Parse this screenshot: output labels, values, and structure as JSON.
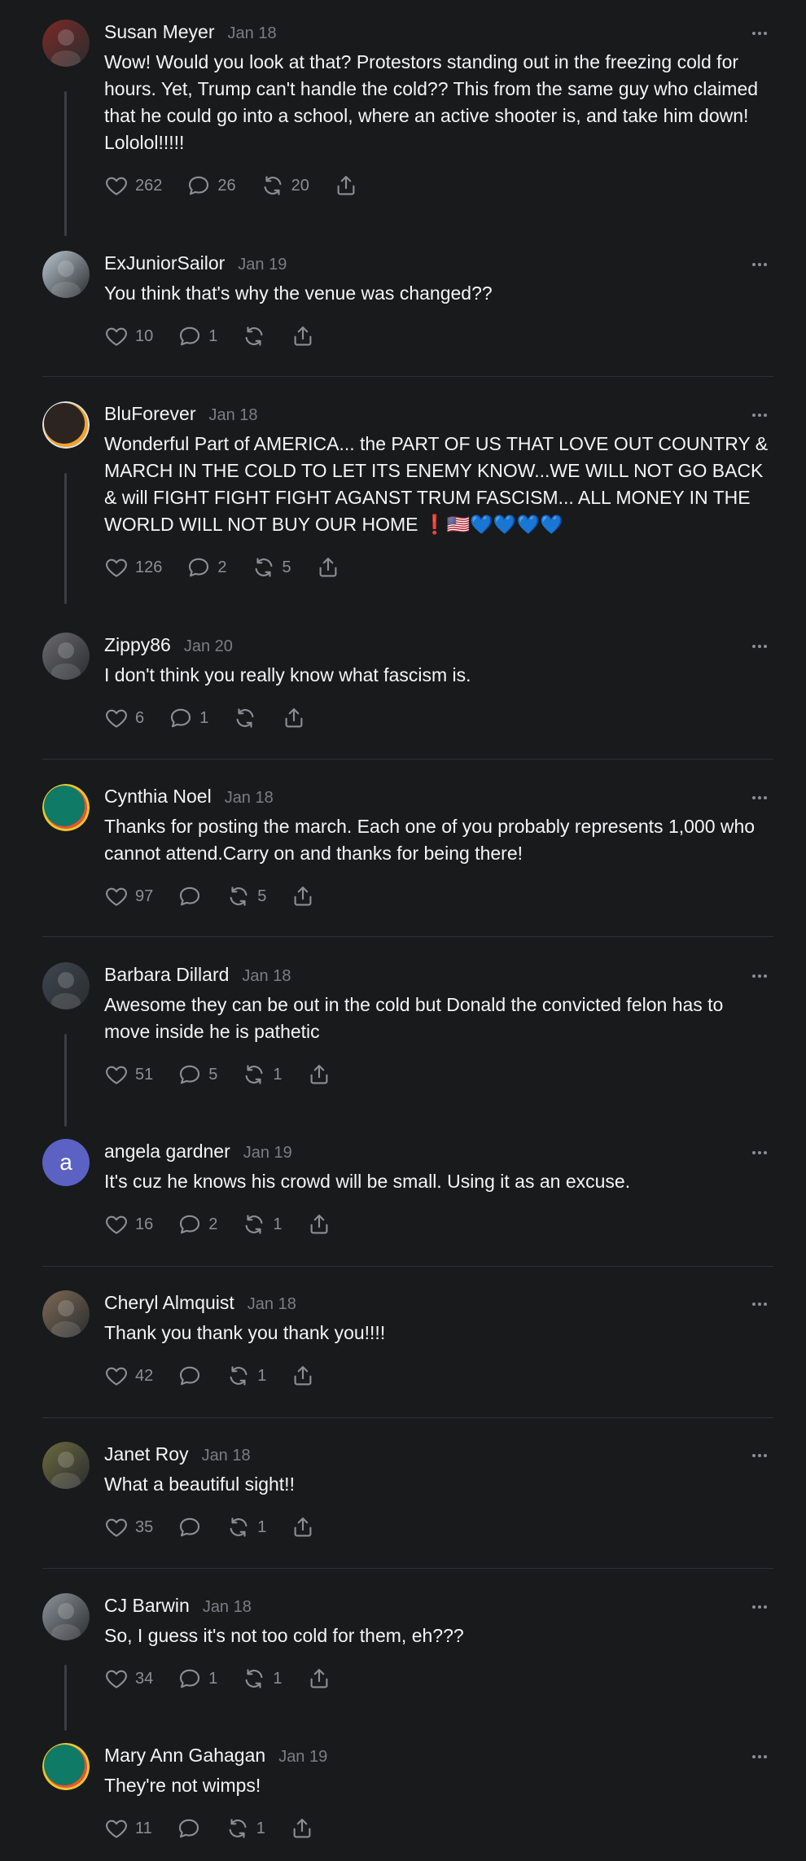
{
  "posts": [
    {
      "name": "Susan Meyer",
      "date": "Jan 18",
      "text": "Wow! Would you look at that? Protestors standing out in the freezing cold for hours. Yet, Trump can't handle the cold?? This from the same guy who claimed that he could go into a school, where an active shooter is, and take him down! Lololol!!!!!",
      "likes": "262",
      "replies": "26",
      "reposts": "20",
      "avatar_color": "#7a2a26"
    },
    {
      "name": "ExJuniorSailor",
      "date": "Jan 19",
      "text": "You think that's why the venue was changed??",
      "likes": "10",
      "replies": "1",
      "reposts": "",
      "avatar_color": "#b9c6cf"
    },
    {
      "name": "BluForever",
      "date": "Jan 18",
      "text": "Wonderful Part of AMERICA... the PART OF US THAT LOVE OUT COUNTRY & MARCH IN THE COLD TO LET ITS ENEMY KNOW...WE WILL NOT GO BACK & will FIGHT FIGHT FIGHT AGANST TRUM FASCISM... ALL MONEY IN THE WORLD WILL NOT BUY OUR HOME",
      "emoji": [
        "❗",
        "🇺🇸",
        "💙",
        "💙",
        "💙",
        "💙"
      ],
      "likes": "126",
      "replies": "2",
      "reposts": "5",
      "avatar_color": "#3a2f28"
    },
    {
      "name": "Zippy86",
      "date": "Jan 20",
      "text": "I don't think you really know what fascism is.",
      "likes": "6",
      "replies": "1",
      "reposts": "",
      "avatar_color": "#6b6a6e"
    },
    {
      "name": "Cynthia Noel",
      "date": "Jan 18",
      "text": "Thanks for posting the march. Each one of you probably represents 1,000 who cannot attend.Carry on and thanks for being there!",
      "likes": "97",
      "replies": "",
      "reposts": "5",
      "avatar_color": "#0f7a66"
    },
    {
      "name": "Barbara Dillard",
      "date": "Jan 18",
      "text": "Awesome they can be out in the cold but Donald the convicted felon has to move inside he is pathetic",
      "likes": "51",
      "replies": "5",
      "reposts": "1",
      "avatar_color": "#3d4650"
    },
    {
      "name": "angela gardner",
      "date": "Jan 19",
      "text": "It's cuz he knows his crowd will be small. Using it as an excuse.",
      "likes": "16",
      "replies": "2",
      "reposts": "1",
      "avatar_letter": "a",
      "avatar_color": "#5b62c4"
    },
    {
      "name": "Cheryl Almquist",
      "date": "Jan 18",
      "text": "Thank you thank you thank you!!!!",
      "likes": "42",
      "replies": "",
      "reposts": "1",
      "avatar_color": "#7d6a55"
    },
    {
      "name": "Janet Roy",
      "date": "Jan 18",
      "text": "What a beautiful sight!!",
      "likes": "35",
      "replies": "",
      "reposts": "1",
      "avatar_color": "#6c6a3e"
    },
    {
      "name": "CJ Barwin",
      "date": "Jan 18",
      "text": "So, I guess it's not too cold for them, eh???",
      "likes": "34",
      "replies": "1",
      "reposts": "1",
      "avatar_color": "#8d949b"
    },
    {
      "name": "Mary Ann Gahagan",
      "date": "Jan 19",
      "text": "They're not wimps!",
      "likes": "11",
      "replies": "",
      "reposts": "1",
      "avatar_color": "#0f7a66"
    }
  ],
  "colors": {
    "background": "#181a1c",
    "text": "#f3f5f7",
    "muted": "#7a7e83",
    "icon": "#8b8f94",
    "divider": "#2e3135",
    "thread_line": "#3b3e42"
  },
  "icons": {
    "like": "heart-icon",
    "reply": "comment-icon",
    "repost": "repost-icon",
    "share": "share-icon",
    "more": "more-options-icon"
  }
}
